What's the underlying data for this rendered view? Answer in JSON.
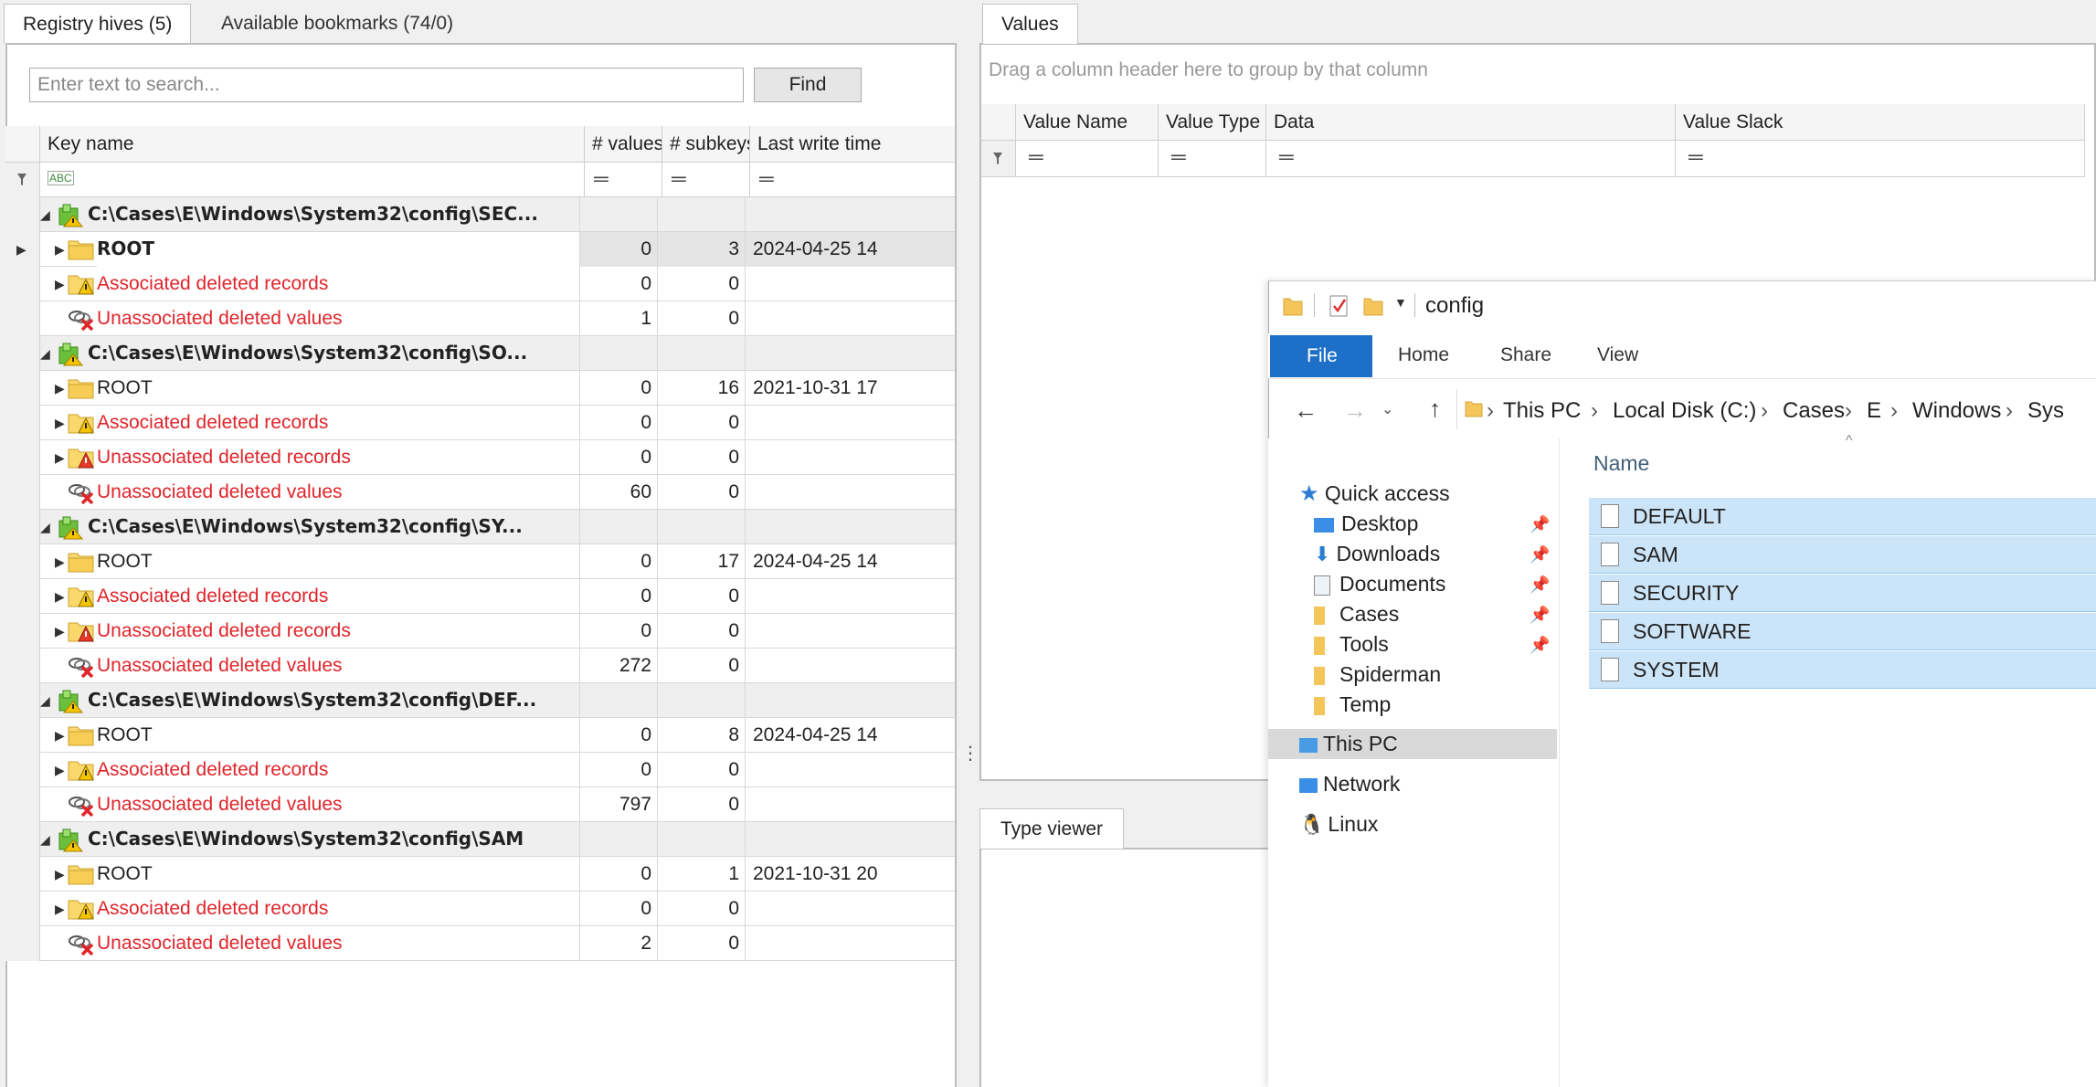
{
  "left_tabs": [
    "Registry hives (5)",
    "Available bookmarks (74/0)"
  ],
  "search": {
    "placeholder": "Enter text to search...",
    "find_label": "Find"
  },
  "grid": {
    "columns": [
      "Key name",
      "# values",
      "# subkeys",
      "Last write time"
    ],
    "filter_abc": "ABC",
    "rows": [
      {
        "kind": "hive",
        "name": "C:\\Cases\\E\\Windows\\System32\\config\\SEC...",
        "values": "",
        "subkeys": "",
        "time": ""
      },
      {
        "kind": "root",
        "name": "ROOT",
        "values": "0",
        "subkeys": "3",
        "time": "2024-04-25 14",
        "selected": true
      },
      {
        "kind": "assoc",
        "name": "Associated deleted records",
        "values": "0",
        "subkeys": "0",
        "time": ""
      },
      {
        "kind": "unvals",
        "name": "Unassociated deleted values",
        "values": "1",
        "subkeys": "0",
        "time": ""
      },
      {
        "kind": "hive",
        "name": "C:\\Cases\\E\\Windows\\System32\\config\\SO...",
        "values": "",
        "subkeys": "",
        "time": ""
      },
      {
        "kind": "root",
        "name": "ROOT",
        "values": "0",
        "subkeys": "16",
        "time": "2021-10-31 17"
      },
      {
        "kind": "assoc",
        "name": "Associated deleted records",
        "values": "0",
        "subkeys": "0",
        "time": ""
      },
      {
        "kind": "unrec",
        "name": "Unassociated deleted records",
        "values": "0",
        "subkeys": "0",
        "time": ""
      },
      {
        "kind": "unvals",
        "name": "Unassociated deleted values",
        "values": "60",
        "subkeys": "0",
        "time": ""
      },
      {
        "kind": "hive",
        "name": "C:\\Cases\\E\\Windows\\System32\\config\\SY...",
        "values": "",
        "subkeys": "",
        "time": ""
      },
      {
        "kind": "root",
        "name": "ROOT",
        "values": "0",
        "subkeys": "17",
        "time": "2024-04-25 14"
      },
      {
        "kind": "assoc",
        "name": "Associated deleted records",
        "values": "0",
        "subkeys": "0",
        "time": ""
      },
      {
        "kind": "unrec",
        "name": "Unassociated deleted records",
        "values": "0",
        "subkeys": "0",
        "time": ""
      },
      {
        "kind": "unvals",
        "name": "Unassociated deleted values",
        "values": "272",
        "subkeys": "0",
        "time": ""
      },
      {
        "kind": "hive",
        "name": "C:\\Cases\\E\\Windows\\System32\\config\\DEF...",
        "values": "",
        "subkeys": "",
        "time": ""
      },
      {
        "kind": "root",
        "name": "ROOT",
        "values": "0",
        "subkeys": "8",
        "time": "2024-04-25 14"
      },
      {
        "kind": "assoc",
        "name": "Associated deleted records",
        "values": "0",
        "subkeys": "0",
        "time": ""
      },
      {
        "kind": "unvals",
        "name": "Unassociated deleted values",
        "values": "797",
        "subkeys": "0",
        "time": ""
      },
      {
        "kind": "hive",
        "name": "C:\\Cases\\E\\Windows\\System32\\config\\SAM",
        "values": "",
        "subkeys": "",
        "time": ""
      },
      {
        "kind": "root",
        "name": "ROOT",
        "values": "0",
        "subkeys": "1",
        "time": "2021-10-31 20"
      },
      {
        "kind": "assoc",
        "name": "Associated deleted records",
        "values": "0",
        "subkeys": "0",
        "time": ""
      },
      {
        "kind": "unvals",
        "name": "Unassociated deleted values",
        "values": "2",
        "subkeys": "0",
        "time": ""
      }
    ]
  },
  "values_pane": {
    "tab": "Values",
    "group_hint": "Drag a column header here to group by that column",
    "columns": [
      "Value Name",
      "Value Type",
      "Data",
      "Value Slack"
    ]
  },
  "type_viewer": {
    "tab": "Type viewer"
  },
  "explorer": {
    "title": "config",
    "ribbon": [
      "File",
      "Home",
      "Share",
      "View"
    ],
    "breadcrumb": [
      "This PC",
      "Local Disk (C:)",
      "Cases",
      "E",
      "Windows",
      "Sys"
    ],
    "nav": {
      "quick_access": "Quick access",
      "pinned": [
        "Desktop",
        "Downloads",
        "Documents",
        "Cases",
        "Tools"
      ],
      "others": [
        "Spiderman",
        "Temp"
      ],
      "this_pc": "This PC",
      "network": "Network",
      "linux": "Linux"
    },
    "column_name": "Name",
    "files": [
      "DEFAULT",
      "SAM",
      "SECURITY",
      "SOFTWARE",
      "SYSTEM"
    ]
  },
  "colors": {
    "deleted_red": "#e0242a",
    "selection_blue": "#cce4f7",
    "file_tab_blue": "#1e6fc8"
  }
}
